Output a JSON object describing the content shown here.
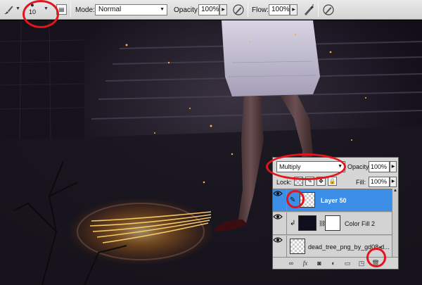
{
  "options_bar": {
    "tool": "brush-tool-icon",
    "brush_size": "10",
    "mode_label": "Mode:",
    "mode_value": "Normal",
    "opacity_label": "Opacity:",
    "opacity_value": "100%",
    "flow_label": "Flow:",
    "flow_value": "100%"
  },
  "layers_panel": {
    "blend_mode": "Multiply",
    "opacity_label": "Opacity:",
    "opacity_value": "100%",
    "lock_label": "Lock:",
    "fill_label": "Fill:",
    "fill_value": "100%",
    "layers": [
      {
        "name": "Layer 50",
        "selected": true,
        "clipped": true
      },
      {
        "name": "Color Fill 2",
        "selected": false,
        "clipped": true
      },
      {
        "name": "dead_tree_png_by_gd08-d...",
        "selected": false,
        "clipped": false
      }
    ],
    "bottom_icons": [
      "link-icon",
      "fx-icon",
      "mask-icon",
      "adjustment-icon",
      "group-icon",
      "new-layer-icon",
      "trash-icon"
    ]
  },
  "colors": {
    "selection": "#3d8ee6",
    "annotation": "#e3141c",
    "glow": "#ffb030"
  }
}
